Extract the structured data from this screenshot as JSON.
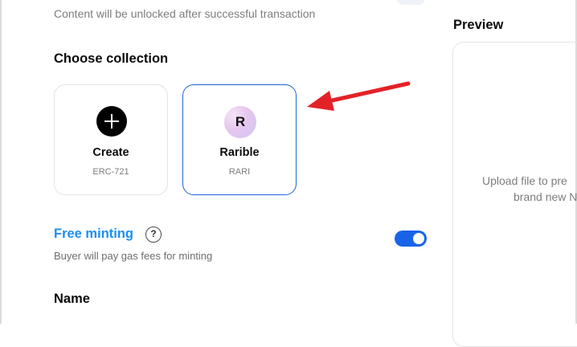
{
  "unlock_hint": "Content will be unlocked after successful transaction",
  "collection": {
    "title": "Choose collection",
    "options": [
      {
        "name": "Create",
        "sub": "ERC-721",
        "icon": "plus-icon",
        "selected": false
      },
      {
        "name": "Rarible",
        "sub": "RARI",
        "icon": "rarible-logo-icon",
        "icon_letter": "R",
        "selected": true
      }
    ]
  },
  "free_minting": {
    "title": "Free minting",
    "help": "?",
    "description": "Buyer will pay gas fees for minting",
    "enabled": true
  },
  "name_section": {
    "title": "Name"
  },
  "preview": {
    "title": "Preview",
    "line1": "Upload file to pre",
    "line2": "brand new N"
  },
  "colors": {
    "accent": "#1a8ff0",
    "toggle_on": "#1963e8",
    "selected_border": "#1f63d6",
    "annotation_arrow": "#e32228"
  }
}
